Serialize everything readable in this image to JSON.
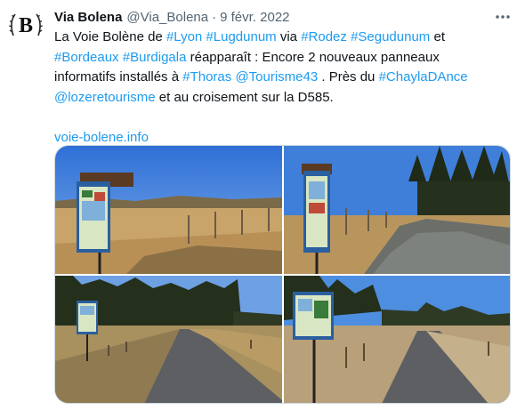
{
  "author": {
    "display_name": "Via Bolena",
    "handle": "@Via_Bolena",
    "separator": "·",
    "date": "9 févr. 2022",
    "avatar_icon": "bolena-b-logo"
  },
  "more_icon": "more-horizontal-icon",
  "tweet": {
    "line1_a": "La Voie Bolène de ",
    "tag_lyon": "#Lyon",
    "sp1": " ",
    "tag_lugdunum": "#Lugdunum",
    "line1_b": " via ",
    "tag_rodez": "#Rodez",
    "sp2": " ",
    "tag_segudunum": "#Segudunum",
    "line1_c": " et",
    "tag_bordeaux": "#Bordeaux",
    "sp3": " ",
    "tag_burdigala": "#Burdigala",
    "line2_a": " réapparaît : Encore 2 nouveaux panneaux",
    "line3_a": "informatifs installés à ",
    "tag_thoras": "#Thoras",
    "sp4": " ",
    "tag_tourisme43": "@Tourisme43",
    "line3_b": " . Près du ",
    "tag_chayla": "#ChaylaDAnce",
    "tag_lozere": "@lozeretourisme",
    "line4_a": " et au croisement sur la D585.",
    "link": "voie-bolene.info"
  },
  "media": {
    "photos": [
      {
        "subject": "info-panel-grassland"
      },
      {
        "subject": "info-panel-track"
      },
      {
        "subject": "info-panel-road-forest"
      },
      {
        "subject": "info-panel-road-crossing"
      }
    ],
    "colors": {
      "sky": "#3f7fd9",
      "grass": "#c9a46a",
      "forest": "#2b3a22",
      "road": "#5d5f63",
      "panel": "#2a5fa0"
    }
  }
}
